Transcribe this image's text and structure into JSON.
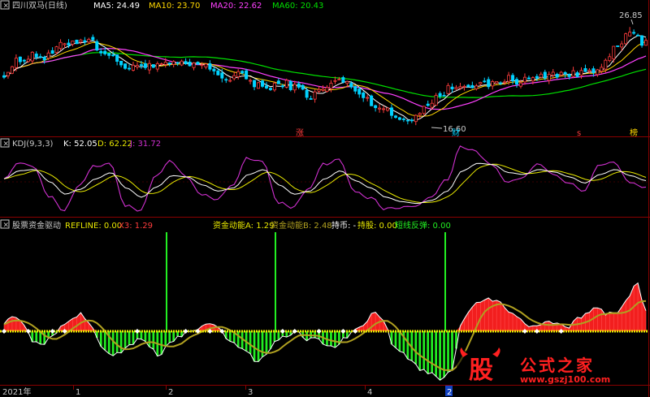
{
  "colors": {
    "bg": "#000000",
    "up": "#ff3c3c",
    "down": "#00d2ff",
    "grid": "#8b0000",
    "ma5": "#ffffff",
    "ma10": "#ffd700",
    "ma20": "#ff40ff",
    "ma60": "#00e000",
    "k": "#ffffff",
    "d": "#e8e800",
    "j": "#d030d0",
    "fund_red": "#ff2020",
    "fund_green": "#22ee22",
    "yellow": "#e8e800",
    "olive": "#b0a020",
    "text_gray": "#c8c8c8",
    "date_red": "#ff3c3c"
  },
  "price_panel": {
    "legend": {
      "name": "四川双马(日线)",
      "ma5": "MA5: 24.49",
      "ma10": "MA10: 23.70",
      "ma20": "MA20: 22.62",
      "ma60": "MA60: 20.43"
    },
    "annotations": {
      "high": "26.85",
      "low": "16.60"
    },
    "markers": [
      "涨",
      "财",
      "s",
      "榜"
    ]
  },
  "kdj_panel": {
    "legend": {
      "name": "KDJ(9,3,3)",
      "k": "K: 52.05",
      "d": "D: 62.22",
      "j": "J: 31.72"
    }
  },
  "fund_panel": {
    "legend": {
      "name": "股票资金驱动",
      "refline": "REFLINE: 0.00",
      "x3": "X3: 1.29",
      "a": "资金动能A: 1.29",
      "b": "资金动能B: 2.48",
      "hold": "持币: -",
      "holdstock": "持股: 0.00",
      "rebound": "短线反弹: 0.00"
    }
  },
  "date_axis": {
    "labels": [
      "2021年",
      "1",
      "2",
      "3",
      "4",
      "2"
    ]
  },
  "watermark": {
    "char": "股",
    "text": "公式之家",
    "url": "www.gszj100.com"
  },
  "chart_data": [
    {
      "type": "candlestick",
      "title": "四川双马(日线)",
      "ylim": [
        15.5,
        28.5
      ],
      "ma_latest": {
        "MA5": 24.49,
        "MA10": 23.7,
        "MA20": 22.62,
        "MA60": 20.43
      },
      "annotated_high": 26.85,
      "annotated_low": 16.6,
      "close_trend": [
        22.0,
        23.2,
        24.0,
        23.6,
        24.8,
        25.4,
        25.6,
        24.4,
        23.4,
        22.4,
        23.0,
        22.6,
        23.0,
        22.8,
        22.9,
        22.3,
        21.3,
        21.8,
        20.9,
        20.3,
        21.0,
        20.4,
        19.6,
        20.4,
        21.3,
        20.5,
        19.2,
        18.4,
        17.4,
        16.9,
        18.3,
        19.4,
        20.4,
        21.0,
        20.6,
        20.8,
        21.4,
        21.2,
        21.4,
        21.9,
        22.0,
        21.8,
        22.4,
        23.0,
        24.8,
        26.4,
        25.0
      ]
    },
    {
      "type": "line",
      "title": "KDJ(9,3,3)",
      "series": [
        {
          "name": "K",
          "latest": 52.05
        },
        {
          "name": "D",
          "latest": 62.22
        },
        {
          "name": "J",
          "latest": 31.72
        }
      ],
      "k_trend": [
        55,
        68,
        70,
        50,
        30,
        38,
        55,
        65,
        40,
        25,
        42,
        60,
        58,
        45,
        35,
        40,
        62,
        70,
        45,
        30,
        35,
        55,
        68,
        52,
        40,
        25,
        18,
        15,
        20,
        35,
        68,
        80,
        78,
        65,
        62,
        70,
        66,
        58,
        48,
        62,
        70,
        60,
        52
      ]
    },
    {
      "type": "bar",
      "title": "股票资金驱动",
      "series": [
        {
          "name": "REFLINE",
          "latest": 0.0
        },
        {
          "name": "X3",
          "latest": 1.29
        },
        {
          "name": "资金动能A",
          "latest": 1.29
        },
        {
          "name": "资金动能B",
          "latest": 2.48
        },
        {
          "name": "持股",
          "latest": 0.0
        },
        {
          "name": "短线反弹",
          "latest": 0.0
        }
      ],
      "fund_trend": [
        0.6,
        0.9,
        0.5,
        -0.6,
        -0.9,
        -0.2,
        0.3,
        0.8,
        1.1,
        0.3,
        -0.9,
        -1.6,
        -1.3,
        -0.8,
        -0.5,
        -1.0,
        -1.6,
        -0.8,
        -0.3,
        0.0,
        0.2,
        0.5,
        0.3,
        -0.5,
        -1.0,
        -1.4,
        -2.1,
        -1.5,
        -0.6,
        -0.3,
        0.0,
        -0.6,
        -0.4,
        -0.8,
        -1.1,
        -0.5,
        0.0,
        0.5,
        1.3,
        0.7,
        -1.0,
        -1.5,
        -2.0,
        -2.5,
        -2.8,
        -3.2,
        -2.6,
        0.5,
        1.5,
        1.9,
        2.1,
        1.8,
        1.2,
        0.8,
        0.3,
        0.4,
        0.6,
        0.5,
        0.2,
        0.8,
        1.2,
        1.5,
        1.1,
        1.2,
        2.1,
        3.2,
        1.3
      ]
    }
  ]
}
